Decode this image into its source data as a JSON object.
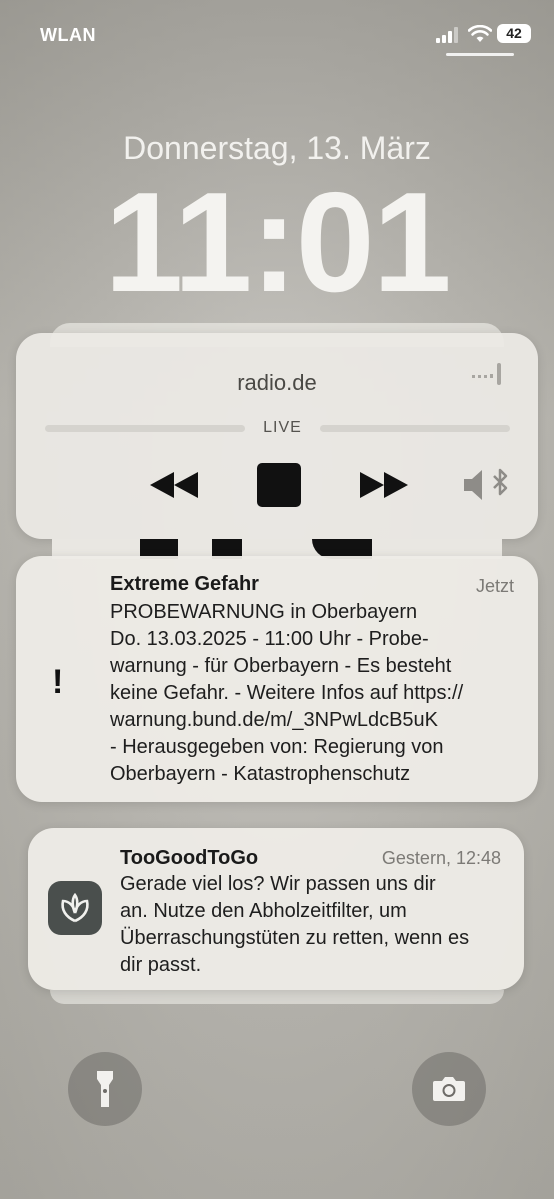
{
  "status_bar": {
    "carrier": "WLAN",
    "battery": "42",
    "icons": [
      "signal-icon",
      "wifi-icon",
      "battery-icon"
    ]
  },
  "lock": {
    "date": "Donnerstag, 13. März",
    "time": "11:01"
  },
  "media": {
    "app": "radio.de",
    "live_label": "LIVE",
    "controls": [
      "rewind-icon",
      "stop-icon",
      "fast-forward-icon",
      "bluetooth-speaker-icon",
      "airplay-icon"
    ]
  },
  "alert": {
    "title": "Extreme Gefahr",
    "time": "Jetzt",
    "icon": "!",
    "body_lines": [
      "PROBEWARNUNG in Oberbayern",
      "Do. 13.03.2025 - 11:00 Uhr - Probe-",
      "warnung - für Oberbayern - Es besteht",
      "keine Gefahr. - Weitere Infos auf https://",
      "warnung.bund.de/m/_3NPwLdcB5uK",
      "- Herausgegeben von: Regierung von",
      "Oberbayern - Katastrophenschutz"
    ]
  },
  "tgtg": {
    "title": "TooGoodToGo",
    "time": "Gestern, 12:48",
    "icon": "toogoodtogo-app-icon",
    "body_lines": [
      "Gerade viel los? Wir passen uns dir",
      "an. Nutze den Abholzeitfilter, um",
      "Überraschungstüten zu retten, wenn es",
      "dir passt."
    ]
  },
  "bottom": {
    "left": "flashlight-icon",
    "right": "camera-icon"
  },
  "colors": {
    "background": "#b9b7b1",
    "card": "#eeece7",
    "app_icon": "#4a4f4d"
  }
}
